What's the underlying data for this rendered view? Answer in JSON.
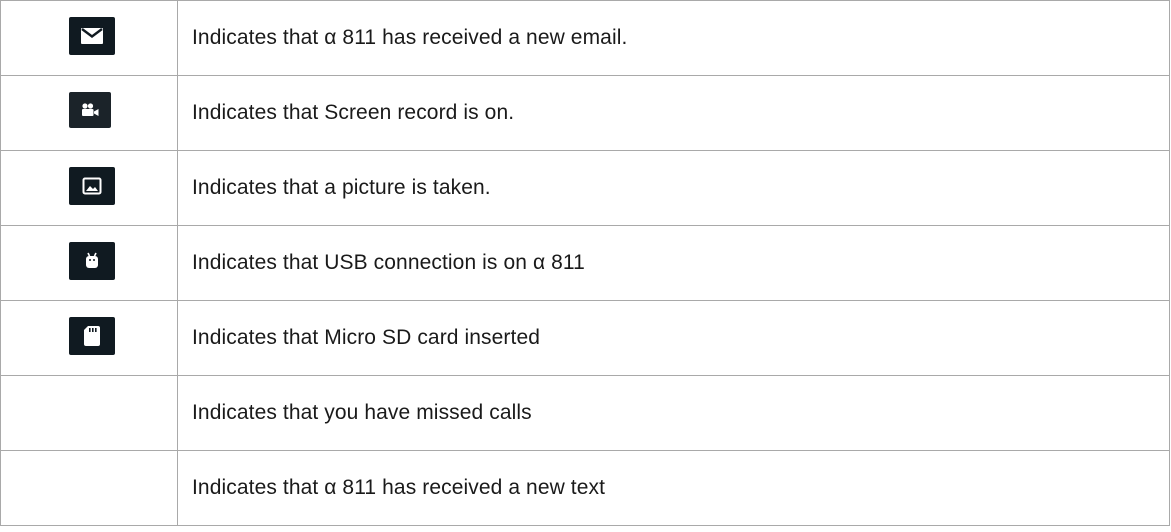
{
  "rows": [
    {
      "icon": "email-icon",
      "text": "Indicates that α 811 has received a new email."
    },
    {
      "icon": "video-camera-icon",
      "text": "Indicates that Screen record is on."
    },
    {
      "icon": "picture-icon",
      "text": "Indicates that a picture is taken."
    },
    {
      "icon": "android-usb-icon",
      "text": "Indicates that USB connection is on α 811"
    },
    {
      "icon": "sd-card-icon",
      "text": "Indicates that Micro SD card inserted"
    },
    {
      "icon": "",
      "text": "Indicates that you have missed calls"
    },
    {
      "icon": "",
      "text": "Indicates that α 811 has received a new text"
    }
  ],
  "colors": {
    "icon_bg": "#101a21",
    "border": "#a9a9a9",
    "text": "#1a1a1a"
  }
}
